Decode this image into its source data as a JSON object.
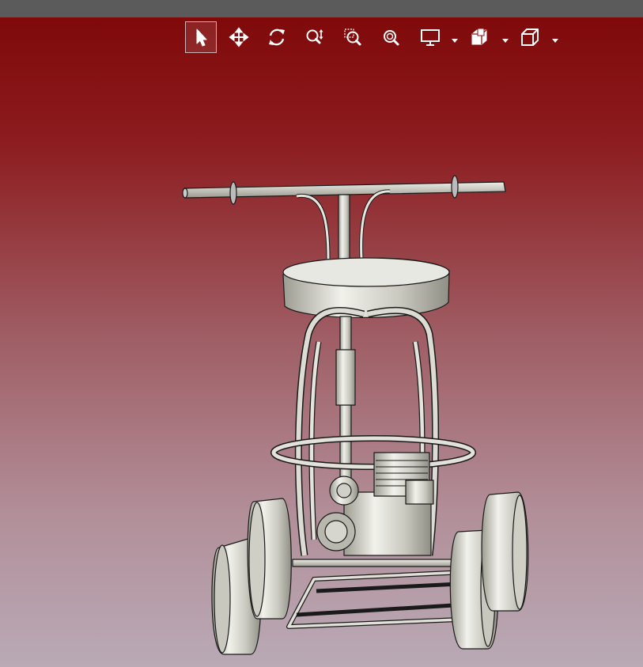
{
  "window": {
    "title_bar": ""
  },
  "toolbar": {
    "buttons": [
      {
        "id": "select",
        "icon": "arrow-cursor-icon",
        "active": true
      },
      {
        "id": "pan",
        "icon": "move-arrows-icon",
        "active": false
      },
      {
        "id": "rotate",
        "icon": "rotate-icon",
        "active": false
      },
      {
        "id": "zoom",
        "icon": "zoom-updown-icon",
        "active": false
      },
      {
        "id": "zoom-window",
        "icon": "zoom-window-icon",
        "active": false
      },
      {
        "id": "zoom-fit",
        "icon": "zoom-fit-icon",
        "active": false
      },
      {
        "id": "display-mode",
        "icon": "monitor-icon",
        "dropdown": true
      },
      {
        "id": "section",
        "icon": "section-box-icon",
        "dropdown": true
      },
      {
        "id": "view-orientation",
        "icon": "cube-icon",
        "dropdown": true
      }
    ]
  },
  "colors": {
    "bg_top": "#7e0707",
    "bg_bottom": "#b9aab6",
    "title_bar": "#5b5b5b",
    "icon": "#ffffff",
    "model_fill": "#d9d9d0",
    "model_edge": "#1a1a1a"
  },
  "viewport": {
    "model_name": ""
  }
}
